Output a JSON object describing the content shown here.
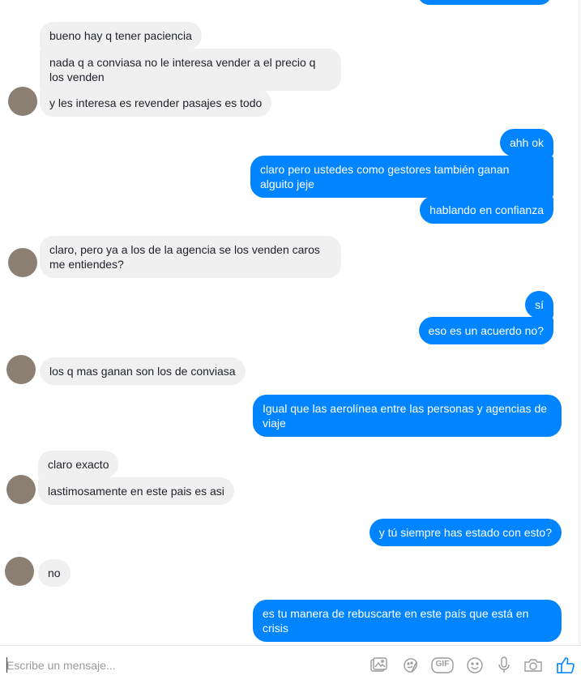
{
  "messages": [
    {
      "side": "out",
      "text": ""
    },
    {
      "side": "in",
      "text": "bueno hay q tener paciencia"
    },
    {
      "side": "in",
      "text": "nada q a conviasa no le interesa vender a el precio q los venden"
    },
    {
      "side": "in",
      "text": "y les interesa es revender pasajes es todo"
    },
    {
      "side": "out",
      "text": "ahh ok"
    },
    {
      "side": "out",
      "text": "claro pero ustedes como gestores también ganan alguito jeje"
    },
    {
      "side": "out",
      "text": "hablando en confianza"
    },
    {
      "side": "in",
      "text": "claro, pero ya a los de la agencia se los venden caros me entiendes?"
    },
    {
      "side": "out",
      "text": "sí"
    },
    {
      "side": "out",
      "text": "eso es un acuerdo no?"
    },
    {
      "side": "in",
      "text": "los q mas ganan son los de conviasa"
    },
    {
      "side": "out",
      "text": "Igual que las aerolínea entre las personas y agencias de viaje"
    },
    {
      "side": "in",
      "text": "claro exacto"
    },
    {
      "side": "in",
      "text": "lastimosamente en este pais es asi"
    },
    {
      "side": "out",
      "text": "y tú siempre has estado con esto?"
    },
    {
      "side": "in",
      "text": "no"
    },
    {
      "side": "out",
      "text": "es tu manera de rebuscarte en este país que está en crisis"
    }
  ],
  "composer": {
    "placeholder": "Escribe un mensaje...",
    "value": ""
  },
  "toolbar": [
    {
      "name": "photo-icon"
    },
    {
      "name": "sticker-icon"
    },
    {
      "name": "gif-icon",
      "label": "GIF"
    },
    {
      "name": "emoji-icon"
    },
    {
      "name": "microphone-icon"
    },
    {
      "name": "camera-icon"
    },
    {
      "name": "like-icon"
    }
  ],
  "colors": {
    "outgoing": "#0084ff",
    "incoming": "#f1f0f0",
    "icon": "#9a9a9a",
    "like": "#0084ff"
  }
}
